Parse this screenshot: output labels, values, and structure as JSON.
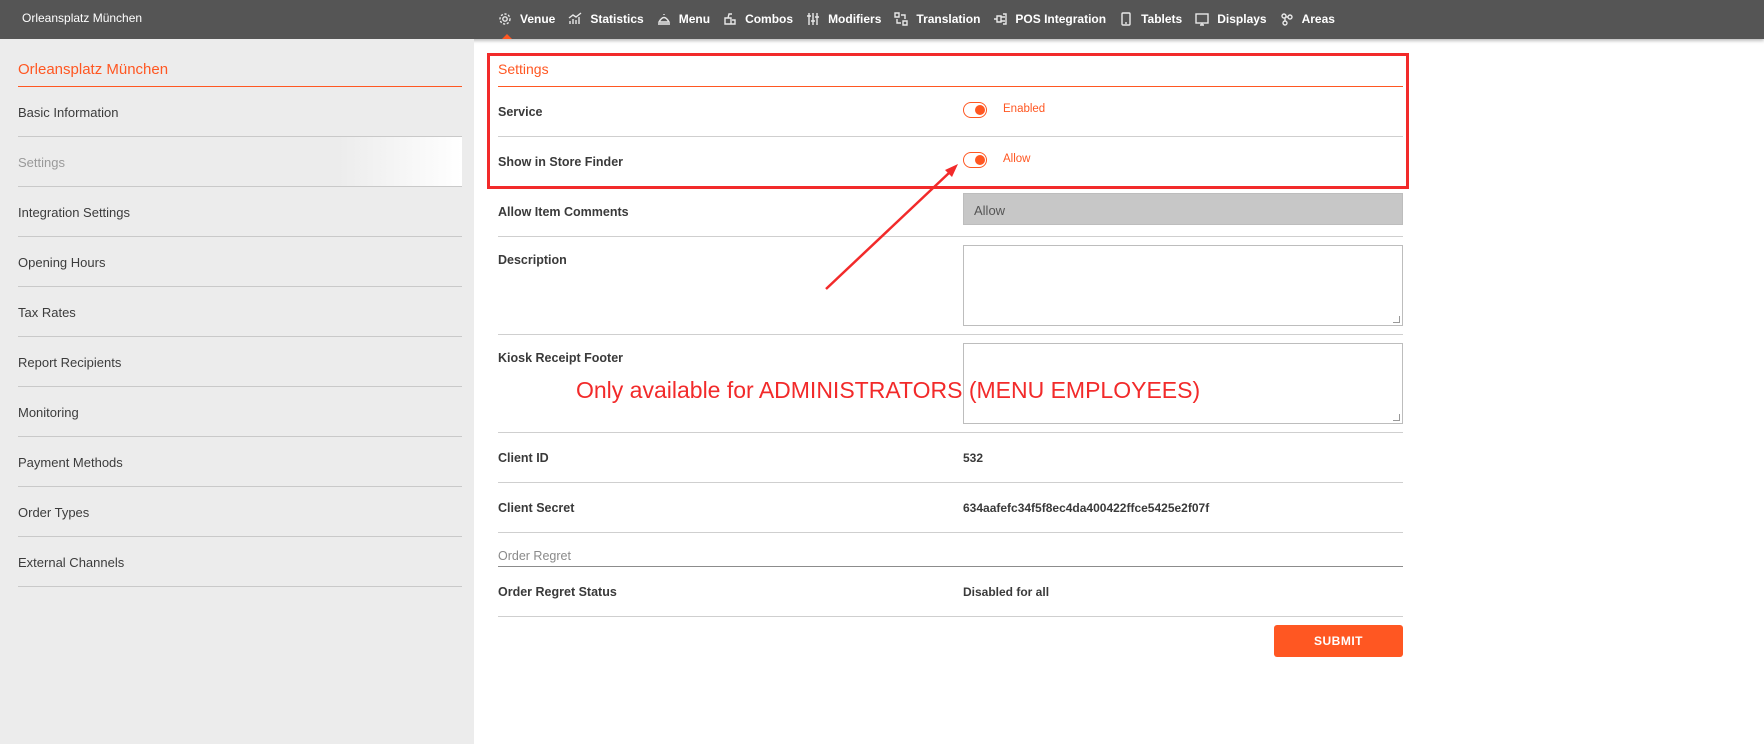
{
  "topbar": {
    "brand": "Orleansplatz München",
    "nav": [
      {
        "label": "Venue",
        "icon": "gear-icon",
        "active": true
      },
      {
        "label": "Statistics",
        "icon": "chart-icon"
      },
      {
        "label": "Menu",
        "icon": "cloche-icon"
      },
      {
        "label": "Combos",
        "icon": "combo-icon"
      },
      {
        "label": "Modifiers",
        "icon": "sliders-icon"
      },
      {
        "label": "Translation",
        "icon": "translate-icon"
      },
      {
        "label": "POS Integration",
        "icon": "plug-icon"
      },
      {
        "label": "Tablets",
        "icon": "tablet-icon"
      },
      {
        "label": "Displays",
        "icon": "display-icon"
      },
      {
        "label": "Areas",
        "icon": "areas-icon"
      }
    ]
  },
  "sidebar": {
    "title": "Orleansplatz München",
    "items": [
      {
        "label": "Basic Information"
      },
      {
        "label": "Settings",
        "active": true
      },
      {
        "label": "Integration Settings"
      },
      {
        "label": "Opening Hours"
      },
      {
        "label": "Tax Rates"
      },
      {
        "label": "Report Recipients"
      },
      {
        "label": "Monitoring"
      },
      {
        "label": "Payment Methods"
      },
      {
        "label": "Order Types"
      },
      {
        "label": "External Channels"
      }
    ]
  },
  "form": {
    "section_title": "Settings",
    "service": {
      "label": "Service",
      "state": "Enabled"
    },
    "store_finder": {
      "label": "Show in Store Finder",
      "state": "Allow"
    },
    "item_comments": {
      "label": "Allow Item Comments",
      "value": "Allow"
    },
    "description": {
      "label": "Description"
    },
    "kiosk_footer": {
      "label": "Kiosk Receipt Footer"
    },
    "client_id": {
      "label": "Client ID",
      "value": "532"
    },
    "client_secret": {
      "label": "Client Secret",
      "value": "634aafefc34f5f8ec4da400422ffce5425e2f07f"
    },
    "order_regret_heading": "Order Regret",
    "order_regret_status": {
      "label": "Order Regret Status",
      "value": "Disabled for all"
    },
    "submit_label": "SUBMIT"
  },
  "annotation": {
    "text": "Only available for ADMINISTRATORS (MENU EMPLOYEES)",
    "color": "#f22a2a"
  },
  "colors": {
    "accent": "#ff5722",
    "topbar": "#555555",
    "sidebar": "#ececec"
  }
}
